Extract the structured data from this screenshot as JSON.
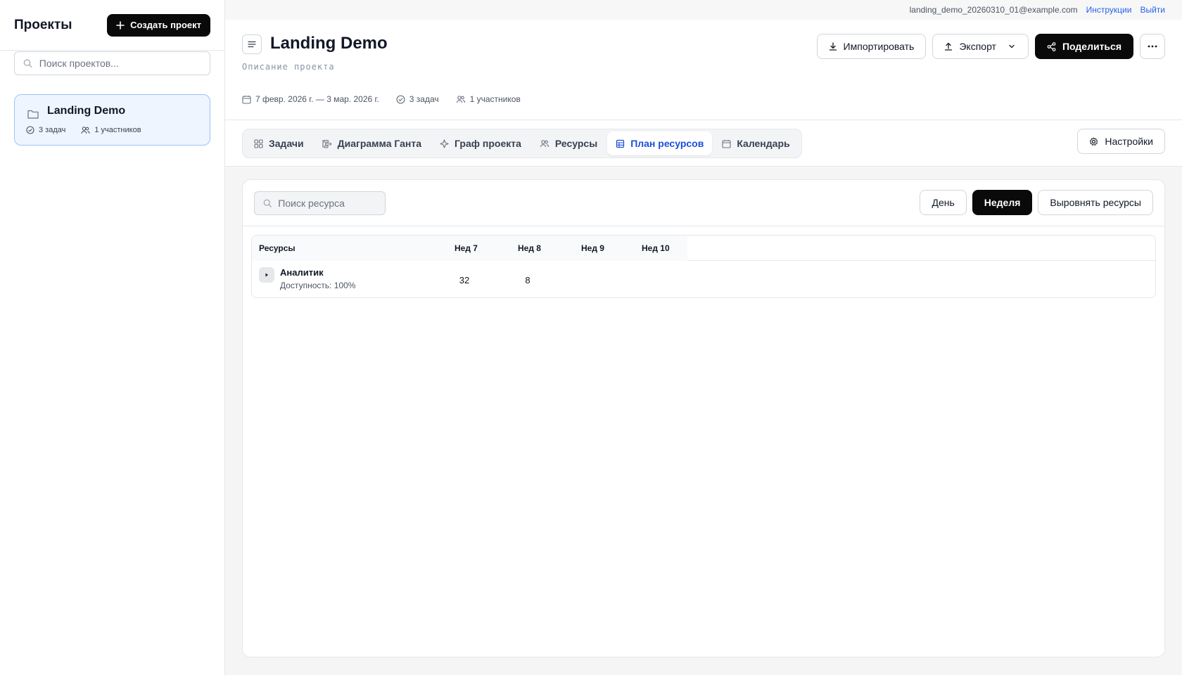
{
  "sidebar": {
    "title": "Проекты",
    "create_label": "Создать проект",
    "search_placeholder": "Поиск проектов...",
    "project": {
      "name": "Landing Demo",
      "tasks": "3 задач",
      "members": "1 участников"
    }
  },
  "topbar": {
    "email": "landing_demo_20260310_01@example.com",
    "help": "Инструкции",
    "logout": "Выйти"
  },
  "header": {
    "title": "Landing Demo",
    "description": "Описание проекта",
    "dates": "7 февр. 2026 г. — 3 мар. 2026 г.",
    "tasks": "3 задач",
    "members": "1 участников",
    "import_label": "Импортировать",
    "export_label": "Экспорт",
    "share_label": "Поделиться"
  },
  "tabs": [
    {
      "label": "Задачи",
      "icon": "grid-icon"
    },
    {
      "label": "Диаграмма Ганта",
      "icon": "gantt-icon"
    },
    {
      "label": "Граф проекта",
      "icon": "sparkle-icon"
    },
    {
      "label": "Ресурсы",
      "icon": "users-icon"
    },
    {
      "label": "План ресурсов",
      "icon": "plan-icon",
      "active": true
    },
    {
      "label": "Календарь",
      "icon": "calendar-icon"
    }
  ],
  "settings_label": "Настройки",
  "resource_plan": {
    "search_placeholder": "Поиск ресурса",
    "view_day": "День",
    "view_week": "Неделя",
    "view_active": "Неделя",
    "level_label": "Выровнять ресурсы",
    "columns": [
      "Ресурсы",
      "Нед 7",
      "Нед 8",
      "Нед 9",
      "Нед 10"
    ],
    "rows": [
      {
        "name": "Аналитик",
        "availability": "Доступность: 100%",
        "values": [
          "32",
          "8",
          "",
          ""
        ]
      }
    ]
  },
  "colors": {
    "accent": "#1d4ed8",
    "link": "#2563eb",
    "dark_button": "#0a0a0a",
    "selected_card_bg": "#eef5fe",
    "selected_card_border": "#9cc3f5"
  }
}
